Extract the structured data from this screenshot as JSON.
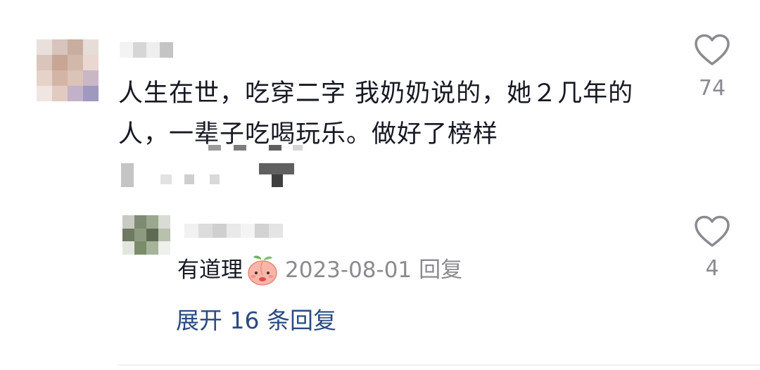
{
  "comment": {
    "text": "人生在世，吃穿二字 我奶奶说的，她２几年的人，一辈子吃喝玩乐。做好了榜样",
    "like_count": "74",
    "like_icon": "heart-outline-icon"
  },
  "reply": {
    "text": "有道理",
    "emoji": "peach-emoji-sticker",
    "date": "2023-08-01",
    "action_label": "回复",
    "like_count": "4",
    "like_icon": "heart-outline-icon"
  },
  "expand_replies_label": "展开 16 条回复",
  "colors": {
    "text": "#161823",
    "meta": "#8a8b91",
    "link": "#2b4a80",
    "icon": "#8a8b91"
  }
}
